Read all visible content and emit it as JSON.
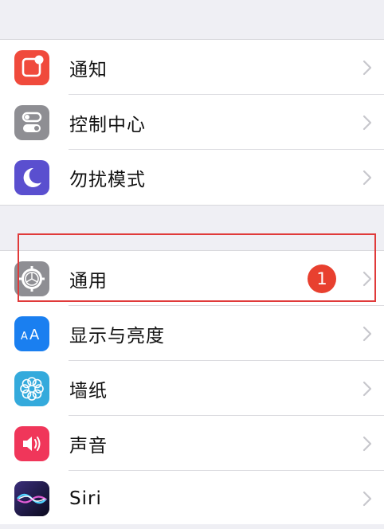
{
  "settings": {
    "group1": [
      {
        "label": "通知",
        "icon": "notifications-icon",
        "color": "#f04a3c"
      },
      {
        "label": "控制中心",
        "icon": "control-center-icon",
        "color": "#8e8e93"
      },
      {
        "label": "勿扰模式",
        "icon": "moon-icon",
        "color": "#5a4fcf"
      }
    ],
    "group2": [
      {
        "label": "通用",
        "icon": "gear-icon",
        "color": "#8e8e93",
        "badge": "1"
      },
      {
        "label": "显示与亮度",
        "icon": "display-brightness-icon",
        "color": "#1a7ff0"
      },
      {
        "label": "墙纸",
        "icon": "wallpaper-flower-icon",
        "color": "#34aadc"
      },
      {
        "label": "声音",
        "icon": "speaker-icon",
        "color": "#f0365a"
      },
      {
        "label": "Siri",
        "icon": "siri-icon",
        "color": "#1a1a3a"
      }
    ]
  },
  "colors": {
    "background": "#efeff4",
    "highlight": "#e03a3a",
    "badge": "#e8402f"
  }
}
